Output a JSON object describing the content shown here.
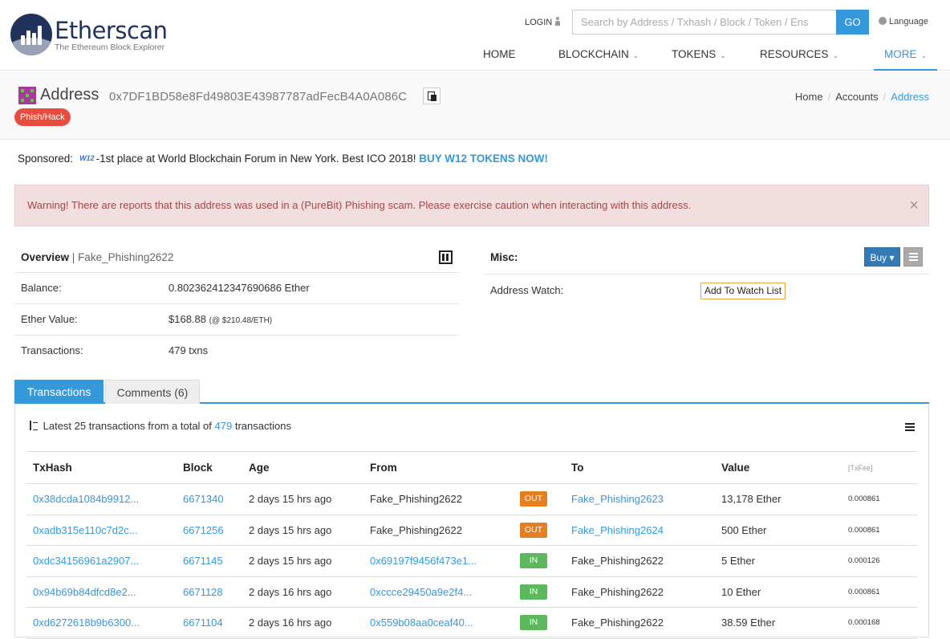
{
  "brand": {
    "name": "Etherscan",
    "tagline": "The Ethereum Block Explorer"
  },
  "header": {
    "login": "LOGIN",
    "search_placeholder": "Search by Address / Txhash / Block / Token / Ens",
    "go": "GO",
    "language": "Language"
  },
  "nav": [
    "HOME",
    "BLOCKCHAIN",
    "TOKENS",
    "RESOURCES",
    "MORE"
  ],
  "address": {
    "label": "Address",
    "hash": "0x7DF1BD58e8Fd49803E43987787adFecB4A0A086C",
    "badge": "Phish/Hack"
  },
  "breadcrumb": [
    "Home",
    "Accounts",
    "Address"
  ],
  "sponsored": {
    "label": "Sponsored:",
    "logo": "W12",
    "text": "-1st place at World Blockchain Forum in New York. Best ICO 2018!",
    "cta": "BUY W12 TOKENS NOW!"
  },
  "alert": "Warning! There are reports that this address was used in a (PureBit) Phishing scam. Please exercise caution when interacting with this address.",
  "overview": {
    "title": "Overview",
    "name": "Fake_Phishing2622",
    "balance_label": "Balance:",
    "balance": "0.802362412347690686 Ether",
    "ether_value_label": "Ether Value:",
    "ether_value": "$168.88",
    "ether_rate": "(@ $210.48/ETH)",
    "tx_label": "Transactions:",
    "tx_value": "479 txns"
  },
  "misc": {
    "title": "Misc:",
    "buy": "Buy",
    "watch_label": "Address Watch:",
    "watch_button": "Add To Watch List"
  },
  "tabs": {
    "transactions": "Transactions",
    "comments": "Comments (6)"
  },
  "summary": {
    "prefix": "Latest 25 transactions from a total of",
    "total": "479",
    "suffix": "transactions"
  },
  "columns": [
    "TxHash",
    "Block",
    "Age",
    "From",
    "",
    "To",
    "Value",
    "[TxFee]"
  ],
  "rows": [
    {
      "hash": "0x38dcda1084b9912...",
      "block": "6671340",
      "age": "2 days 15 hrs ago",
      "from": "Fake_Phishing2622",
      "dir": "OUT",
      "to": "Fake_Phishing2623",
      "value": "13,178 Ether",
      "fee": "0.000861"
    },
    {
      "hash": "0xadb315e110c7d2c...",
      "block": "6671256",
      "age": "2 days 15 hrs ago",
      "from": "Fake_Phishing2622",
      "dir": "OUT",
      "to": "Fake_Phishing2624",
      "value": "500 Ether",
      "fee": "0.000861"
    },
    {
      "hash": "0xdc34156961a2907...",
      "block": "6671145",
      "age": "2 days 15 hrs ago",
      "from": "0x69197f9456f473e1...",
      "dir": "IN",
      "to": "Fake_Phishing2622",
      "value": "5 Ether",
      "fee": "0.000126"
    },
    {
      "hash": "0x94b69b84dfcd8e2...",
      "block": "6671128",
      "age": "2 days 16 hrs ago",
      "from": "0xccce29450a9e2f4...",
      "dir": "IN",
      "to": "Fake_Phishing2622",
      "value": "10 Ether",
      "fee": "0.000861"
    },
    {
      "hash": "0xd6272618b9b6300...",
      "block": "6671104",
      "age": "2 days 16 hrs ago",
      "from": "0x559b08aa0ceaf40...",
      "dir": "IN",
      "to": "Fake_Phishing2622",
      "value": "38.59 Ether",
      "fee": "0.000168"
    }
  ]
}
